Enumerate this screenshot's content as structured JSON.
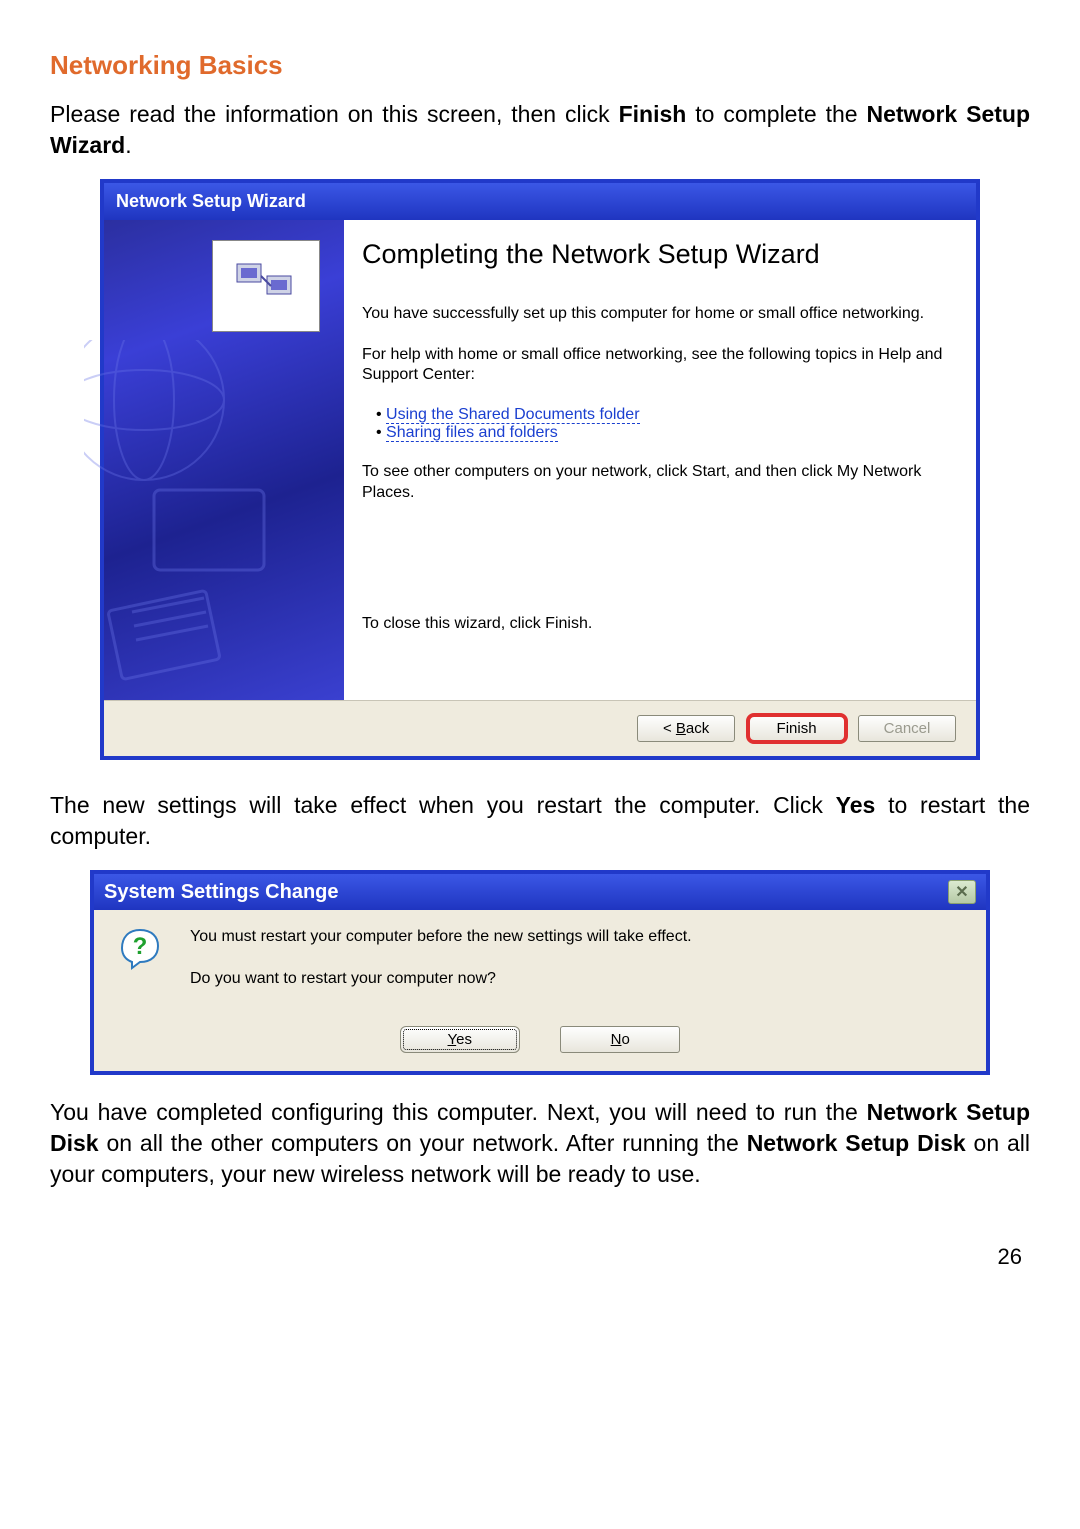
{
  "doc": {
    "section_title": "Networking Basics",
    "intro_plain1": "Please read the information on this screen, then click ",
    "intro_bold1": "Finish",
    "intro_plain2": " to complete the ",
    "intro_bold2": "Network Setup Wizard",
    "intro_plain3": ".",
    "mid_plain1": "The new settings will take effect when you restart the computer.  Click ",
    "mid_bold1": "Yes",
    "mid_plain2": " to restart the computer.",
    "outro_plain1": "You have completed configuring this computer.  Next, you will need to run the ",
    "outro_bold1": "Network Setup Disk",
    "outro_plain2": " on all the other computers on your network.  After running the ",
    "outro_bold2": "Network Setup Disk",
    "outro_plain3": " on all your computers, your new wireless network will be ready to use.",
    "page_number": "26"
  },
  "wizard": {
    "title": "Network Setup Wizard",
    "heading": "Completing the Network Setup Wizard",
    "para1": "You have successfully set up this computer for home or small office networking.",
    "para2": "For help with home or small office networking, see the following topics in Help and Support Center:",
    "link1": "Using the Shared Documents folder",
    "link2": "Sharing files and folders",
    "para3": "To see other computers on your network, click Start, and then click My Network Places.",
    "para_close": "To close this wizard, click Finish.",
    "btn_back_prefix": "< ",
    "btn_back_u": "B",
    "btn_back_rest": "ack",
    "btn_finish": "Finish",
    "btn_cancel": "Cancel"
  },
  "msgbox": {
    "title": "System Settings Change",
    "line1": "You must restart your computer before the new settings will take effect.",
    "line2": "Do you want to restart your computer now?",
    "yes_u": "Y",
    "yes_rest": "es",
    "no_u": "N",
    "no_rest": "o"
  }
}
